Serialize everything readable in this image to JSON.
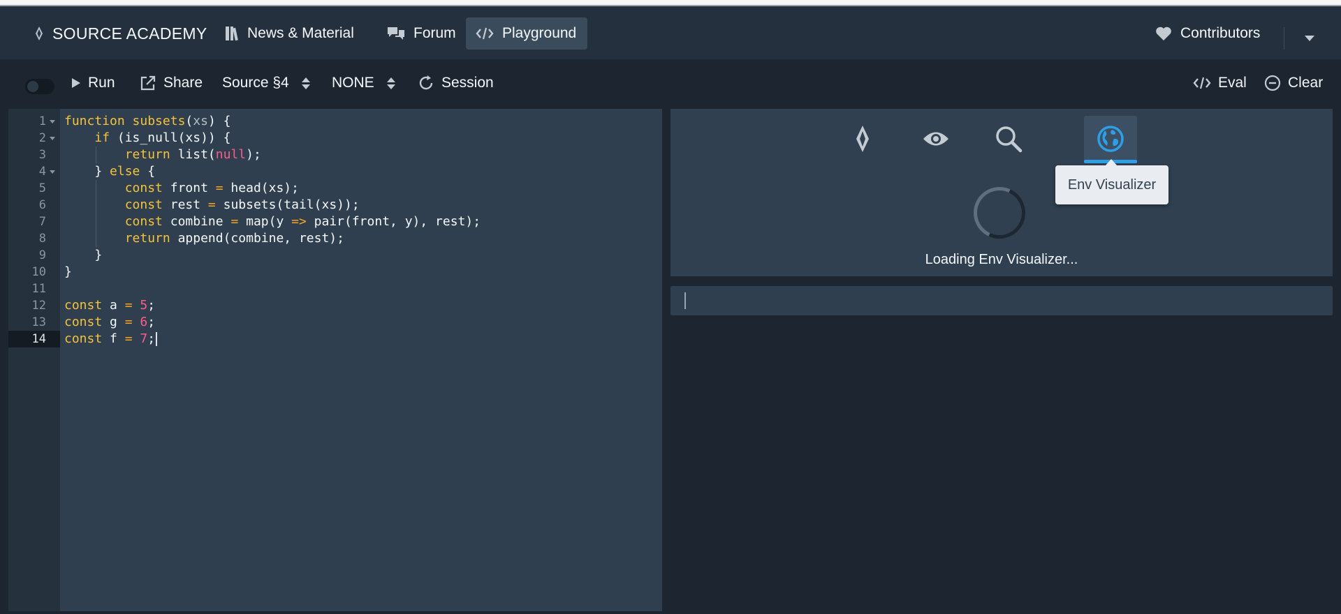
{
  "navbar": {
    "brand": "SOURCE ACADEMY",
    "news": "News & Material",
    "forum": "Forum",
    "playground": "Playground",
    "contributors": "Contributors"
  },
  "toolbar": {
    "run": "Run",
    "share": "Share",
    "chapter": "Source §4",
    "variant": "NONE",
    "session": "Session",
    "eval": "Eval",
    "clear": "Clear"
  },
  "editor": {
    "current_line": 14,
    "lines": [
      "function subsets(xs) {",
      "    if (is_null(xs)) {",
      "        return list(null);",
      "    } else {",
      "        const front = head(xs);",
      "        const rest = subsets(tail(xs));",
      "        const combine = map(y => pair(front, y), rest);",
      "        return append(combine, rest);",
      "    }",
      "}",
      "",
      "const a = 5;",
      "const g = 6;",
      "const f = 7;"
    ]
  },
  "side_panel": {
    "tabs": [
      {
        "icon": "source-academy-icon",
        "label": ""
      },
      {
        "icon": "eye-icon",
        "label": ""
      },
      {
        "icon": "search-icon",
        "label": ""
      },
      {
        "icon": "globe-icon",
        "label": "",
        "active": true
      }
    ],
    "tooltip": "Env Visualizer",
    "loading_text": "Loading Env Visualizer..."
  },
  "colors": {
    "navbar_bg": "#24303d",
    "editor_bg": "#2f3f50",
    "accent": "#2e9fe6",
    "keyword": "#f5c338",
    "number": "#ff5c8a"
  }
}
